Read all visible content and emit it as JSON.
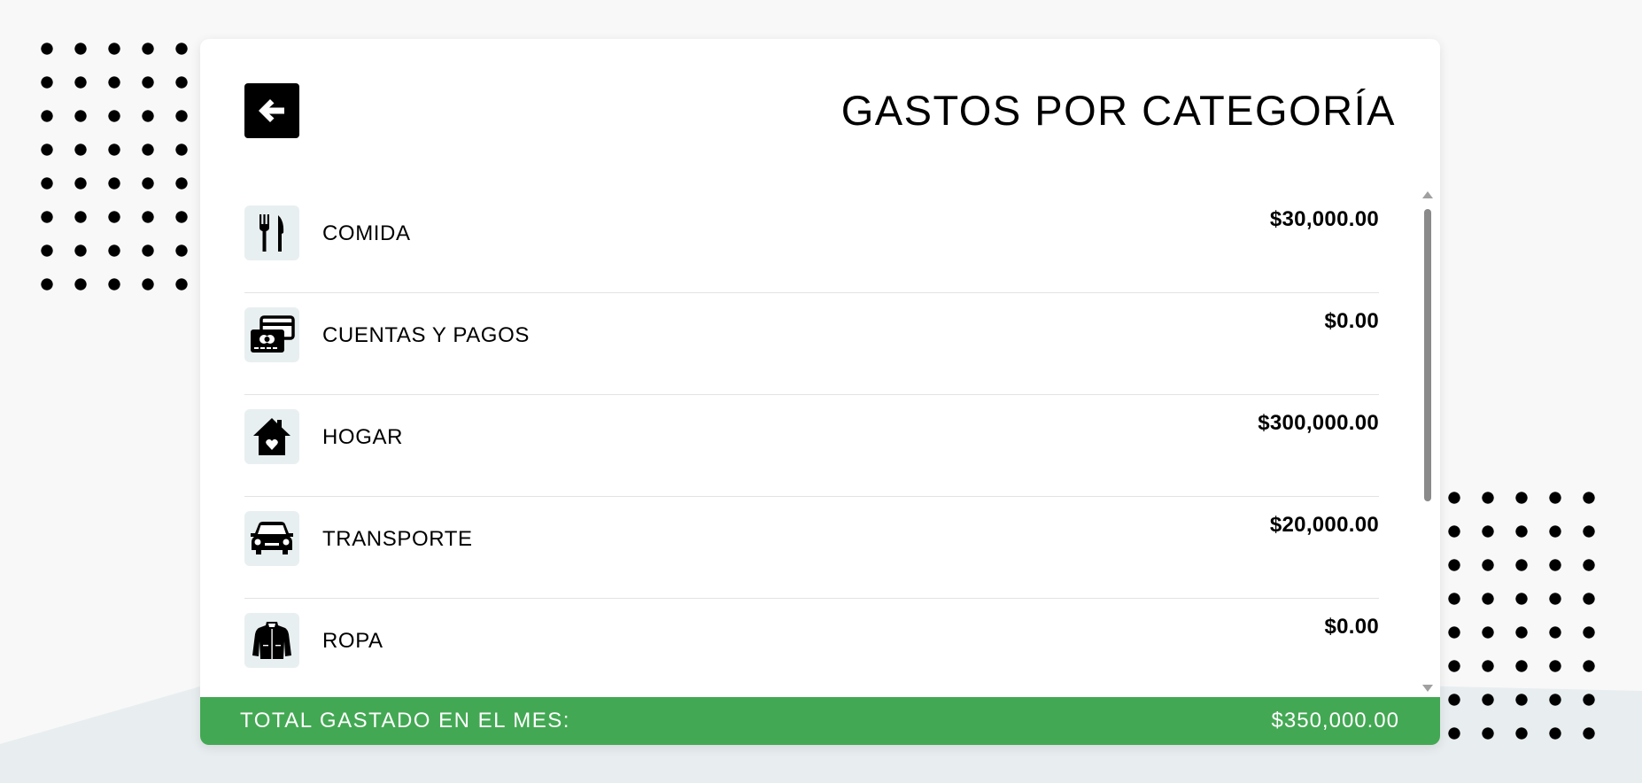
{
  "header": {
    "title": "GASTOS POR CATEGORÍA",
    "back_icon": "arrow-left-icon"
  },
  "categories": [
    {
      "label": "COMIDA",
      "amount": "$30,000.00",
      "icon": "fork-knife-icon"
    },
    {
      "label": "CUENTAS Y PAGOS",
      "amount": "$0.00",
      "icon": "cards-icon"
    },
    {
      "label": "HOGAR",
      "amount": "$300,000.00",
      "icon": "house-icon"
    },
    {
      "label": "TRANSPORTE",
      "amount": "$20,000.00",
      "icon": "car-icon"
    },
    {
      "label": "ROPA",
      "amount": "$0.00",
      "icon": "jacket-icon"
    }
  ],
  "footer": {
    "label": "TOTAL GASTADO EN EL MES:",
    "total": "$350,000.00"
  },
  "colors": {
    "accent": "#43a853",
    "icon_bg": "#e8eff0",
    "page_bg": "#f8f8f8"
  }
}
